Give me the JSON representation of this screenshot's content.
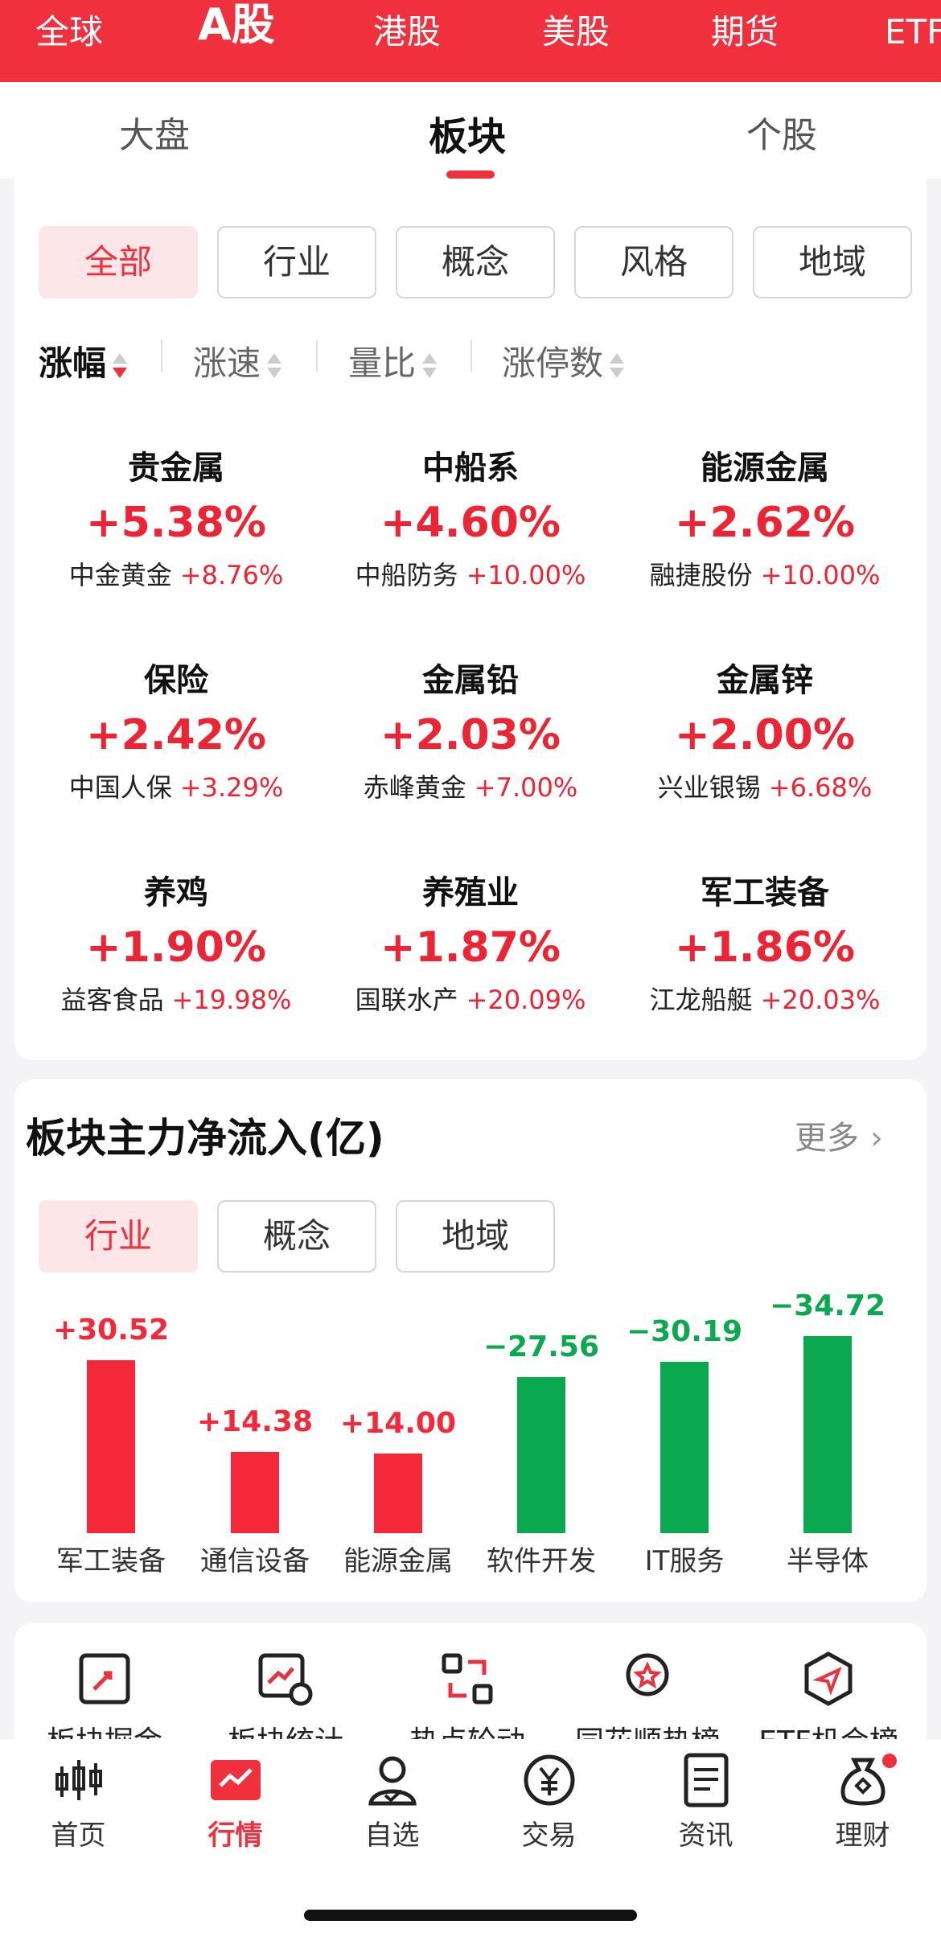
{
  "market_tabs": [
    {
      "label": "全球",
      "active": false
    },
    {
      "label": "A股",
      "active": true
    },
    {
      "label": "港股",
      "active": false
    },
    {
      "label": "美股",
      "active": false
    },
    {
      "label": "期货",
      "active": false
    },
    {
      "label": "ETF",
      "active": false
    }
  ],
  "sub_tabs": [
    {
      "label": "大盘",
      "active": false
    },
    {
      "label": "板块",
      "active": true
    },
    {
      "label": "个股",
      "active": false
    }
  ],
  "filters": [
    {
      "label": "全部",
      "active": true
    },
    {
      "label": "行业",
      "active": false
    },
    {
      "label": "概念",
      "active": false
    },
    {
      "label": "风格",
      "active": false
    },
    {
      "label": "地域",
      "active": false
    }
  ],
  "sorts": [
    {
      "label": "涨幅",
      "active": true
    },
    {
      "label": "涨速",
      "active": false
    },
    {
      "label": "量比",
      "active": false
    },
    {
      "label": "涨停数",
      "active": false
    }
  ],
  "sectors": [
    {
      "name": "贵金属",
      "change": "+5.38%",
      "leader": "中金黄金",
      "leader_change": "+8.76%"
    },
    {
      "name": "中船系",
      "change": "+4.60%",
      "leader": "中船防务",
      "leader_change": "+10.00%"
    },
    {
      "name": "能源金属",
      "change": "+2.62%",
      "leader": "融捷股份",
      "leader_change": "+10.00%"
    },
    {
      "name": "保险",
      "change": "+2.42%",
      "leader": "中国人保",
      "leader_change": "+3.29%"
    },
    {
      "name": "金属铅",
      "change": "+2.03%",
      "leader": "赤峰黄金",
      "leader_change": "+7.00%"
    },
    {
      "name": "金属锌",
      "change": "+2.00%",
      "leader": "兴业银锡",
      "leader_change": "+6.68%"
    },
    {
      "name": "养鸡",
      "change": "+1.90%",
      "leader": "益客食品",
      "leader_change": "+19.98%"
    },
    {
      "name": "养殖业",
      "change": "+1.87%",
      "leader": "国联水产",
      "leader_change": "+20.09%"
    },
    {
      "name": "军工装备",
      "change": "+1.86%",
      "leader": "江龙船艇",
      "leader_change": "+20.03%"
    }
  ],
  "net_flow": {
    "title": "板块主力净流入(亿)",
    "more_label": "更多",
    "tabs": [
      {
        "label": "行业",
        "active": true
      },
      {
        "label": "概念",
        "active": false
      },
      {
        "label": "地域",
        "active": false
      }
    ]
  },
  "chart_data": {
    "type": "bar",
    "categories": [
      "军工装备",
      "通信设备",
      "能源金属",
      "软件开发",
      "IT服务",
      "半导体"
    ],
    "values": [
      30.52,
      14.38,
      14.0,
      -27.56,
      -30.19,
      -34.72
    ],
    "value_labels": [
      "+30.52",
      "+14.38",
      "+14.00",
      "−27.56",
      "−30.19",
      "−34.72"
    ],
    "colors": {
      "positive": "#f5283a",
      "negative": "#0aa84f"
    }
  },
  "tools": [
    {
      "label": "板块掘金",
      "icon": "rocket-chart-icon"
    },
    {
      "label": "板块统计",
      "icon": "chart-clock-icon"
    },
    {
      "label": "热点轮动",
      "icon": "rotate-squares-icon"
    },
    {
      "label": "同花顺热榜",
      "icon": "award-star-icon"
    },
    {
      "label": "ETF机会榜",
      "icon": "navigation-hexagon-icon"
    }
  ],
  "bottom_nav": [
    {
      "label": "首页",
      "icon": "candlestick-icon",
      "active": false
    },
    {
      "label": "行情",
      "icon": "trend-chart-icon",
      "active": true
    },
    {
      "label": "自选",
      "icon": "user-check-icon",
      "active": false
    },
    {
      "label": "交易",
      "icon": "yen-coin-icon",
      "active": false
    },
    {
      "label": "资讯",
      "icon": "news-doc-icon",
      "active": false
    },
    {
      "label": "理财",
      "icon": "money-bag-icon",
      "active": false,
      "badge": true
    }
  ],
  "colors": {
    "accent": "#f0303d",
    "up": "#ed2433",
    "down": "#0aa84f"
  }
}
